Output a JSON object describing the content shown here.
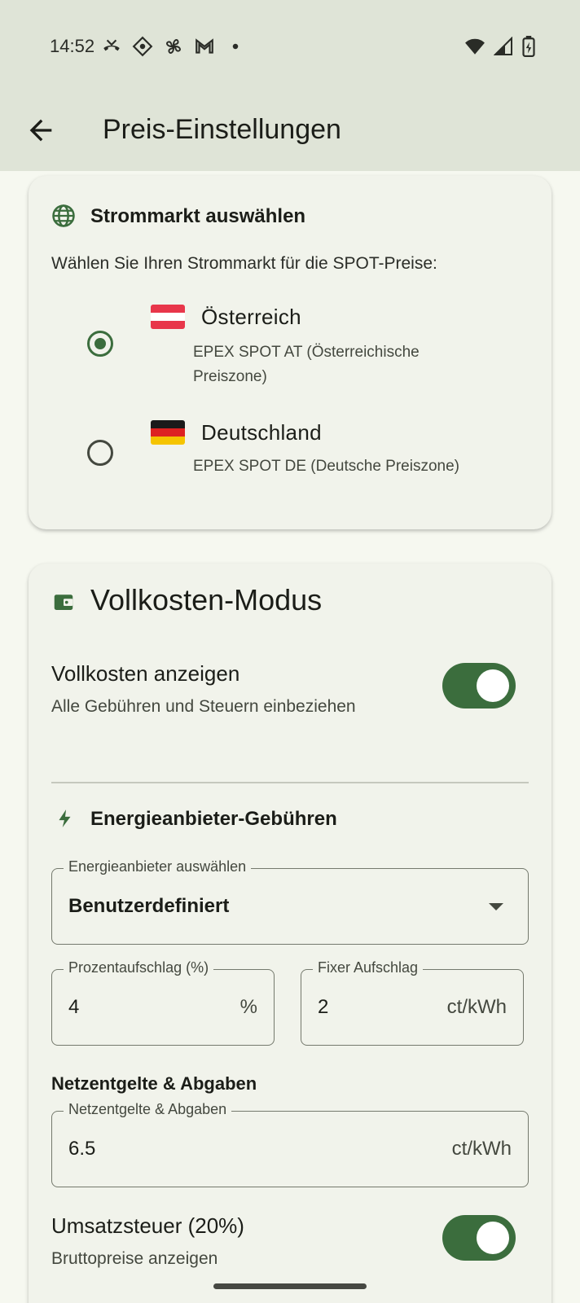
{
  "status_bar": {
    "time": "14:52",
    "left_icons": [
      "missed-call-icon",
      "vpn-diamond-icon",
      "fan-icon",
      "gmail-icon",
      "dot-icon"
    ],
    "right_icons": [
      "wifi-icon",
      "signal-icon",
      "battery-charging-icon"
    ]
  },
  "app_bar": {
    "title": "Preis-Einstellungen",
    "back_icon": "arrow-back-icon"
  },
  "market_card": {
    "icon": "globe-icon",
    "title": "Strommarkt auswählen",
    "description": "Wählen Sie Ihren Strommarkt für die SPOT-Preise:",
    "options": [
      {
        "flag": "austria-flag",
        "name": "Österreich",
        "subtitle": "EPEX SPOT AT (Österreichische Preiszone)",
        "selected": true
      },
      {
        "flag": "germany-flag",
        "name": "Deutschland",
        "subtitle": "EPEX SPOT DE (Deutsche Preiszone)",
        "selected": false
      }
    ]
  },
  "fullcost_card": {
    "icon": "wallet-icon",
    "title": "Vollkosten-Modus",
    "toggle_fullcost": {
      "label": "Vollkosten anzeigen",
      "sublabel": "Alle Gebühren und Steuern einbeziehen",
      "on": true
    },
    "provider_section": {
      "icon": "bolt-icon",
      "title": "Energieanbieter-Gebühren",
      "provider_select": {
        "label": "Energieanbieter auswählen",
        "value": "Benutzerdefiniert"
      },
      "percent_field": {
        "label": "Prozentaufschlag (%)",
        "value": "4",
        "suffix": "%"
      },
      "fixed_field": {
        "label": "Fixer Aufschlag",
        "value": "2",
        "suffix": "ct/kWh"
      }
    },
    "grid_section": {
      "title": "Netzentgelte & Abgaben",
      "grid_field": {
        "label": "Netzentgelte & Abgaben",
        "value": "6.5",
        "suffix": "ct/kWh"
      }
    },
    "toggle_vat": {
      "label": "Umsatzsteuer (20%)",
      "sublabel": "Bruttopreise anzeigen",
      "on": true
    }
  },
  "colors": {
    "primary": "#3b6d3d",
    "app_bar_bg": "#dfe4d7",
    "card_bg": "#f1f3eb",
    "page_bg": "#f6f8f0"
  }
}
